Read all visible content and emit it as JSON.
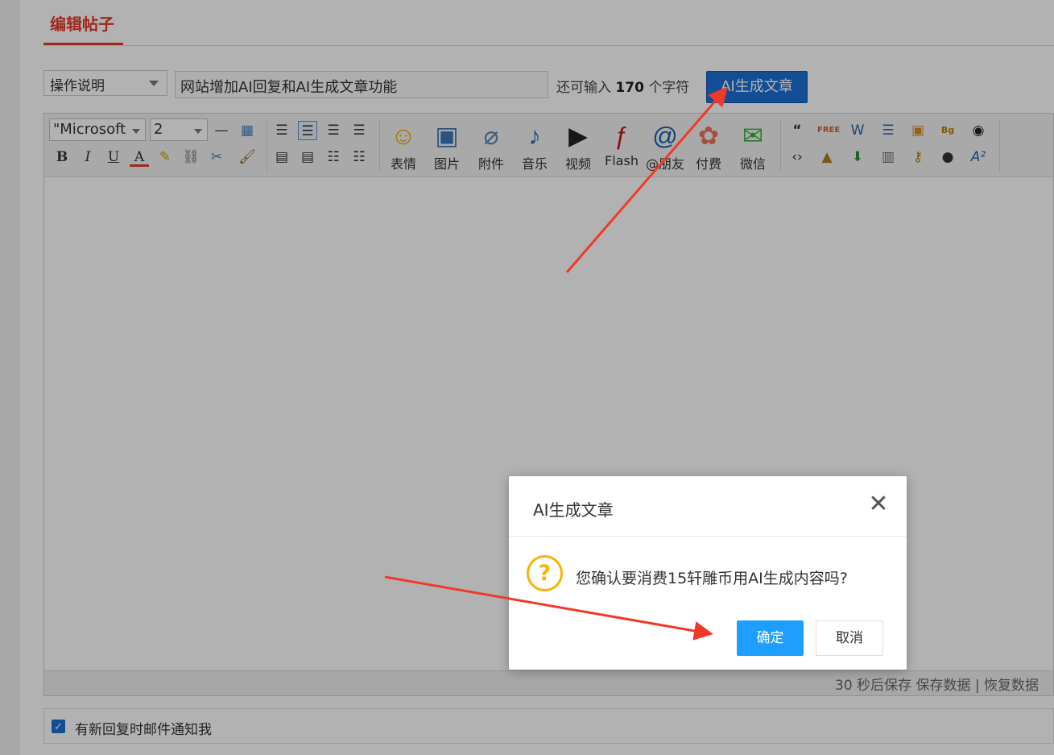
{
  "page": {
    "title": "编辑帖子",
    "accent_color": "#e23b2a"
  },
  "form": {
    "type_select": "操作说明",
    "subject_value": "网站增加AI回复和AI生成文章功能",
    "char_prefix": "还可输入",
    "char_remaining": "170",
    "char_suffix": "个字符",
    "ai_button": "AI生成文章"
  },
  "editor": {
    "font_family_value": "\"Microsoft",
    "font_size_value": "2",
    "small_tools": [
      "bold-icon",
      "italic-icon",
      "underline-icon",
      "font-color-icon",
      "highlight-icon",
      "link-icon",
      "unlink-icon",
      "format-painter-icon",
      "horizontal-rule-icon",
      "table-icon",
      "align-left-icon",
      "align-center-icon",
      "align-right-icon",
      "justify-icon",
      "float-left-icon",
      "float-right-icon",
      "ordered-list-icon",
      "unordered-list-icon"
    ],
    "big_tools": [
      {
        "label": "表情",
        "icon": "emoji-icon"
      },
      {
        "label": "图片",
        "icon": "image-icon"
      },
      {
        "label": "附件",
        "icon": "attachment-icon"
      },
      {
        "label": "音乐",
        "icon": "music-icon"
      },
      {
        "label": "视频",
        "icon": "video-icon"
      },
      {
        "label": "Flash",
        "icon": "flash-icon"
      },
      {
        "label": "@朋友",
        "icon": "at-friend-icon"
      },
      {
        "label": "付费",
        "icon": "pay-icon"
      },
      {
        "label": "微信",
        "icon": "wechat-icon"
      }
    ],
    "extra_tools": [
      "quote-icon",
      "free-icon",
      "word-icon",
      "hide-icon",
      "password-box-icon",
      "bg-icon",
      "qq-icon",
      "code-icon",
      "lock-icon",
      "download-icon",
      "index-icon",
      "key-icon",
      "record-icon",
      "sup-icon"
    ],
    "footer_timer": "30 秒后保存",
    "footer_save": "保存数据",
    "footer_sep": "|",
    "footer_restore": "恢复数据"
  },
  "notify": {
    "checked": true,
    "label": "有新回复时邮件通知我"
  },
  "dialog": {
    "title": "AI生成文章",
    "close_glyph": "✕",
    "question_glyph": "?",
    "message": "您确认要消费15轩雕币用AI生成内容吗?",
    "ok_label": "确定",
    "cancel_label": "取消",
    "ok_color": "#1e9fff",
    "warning_color": "#f5b50a"
  },
  "annotations": {
    "arrow_color": "#f03a28"
  }
}
